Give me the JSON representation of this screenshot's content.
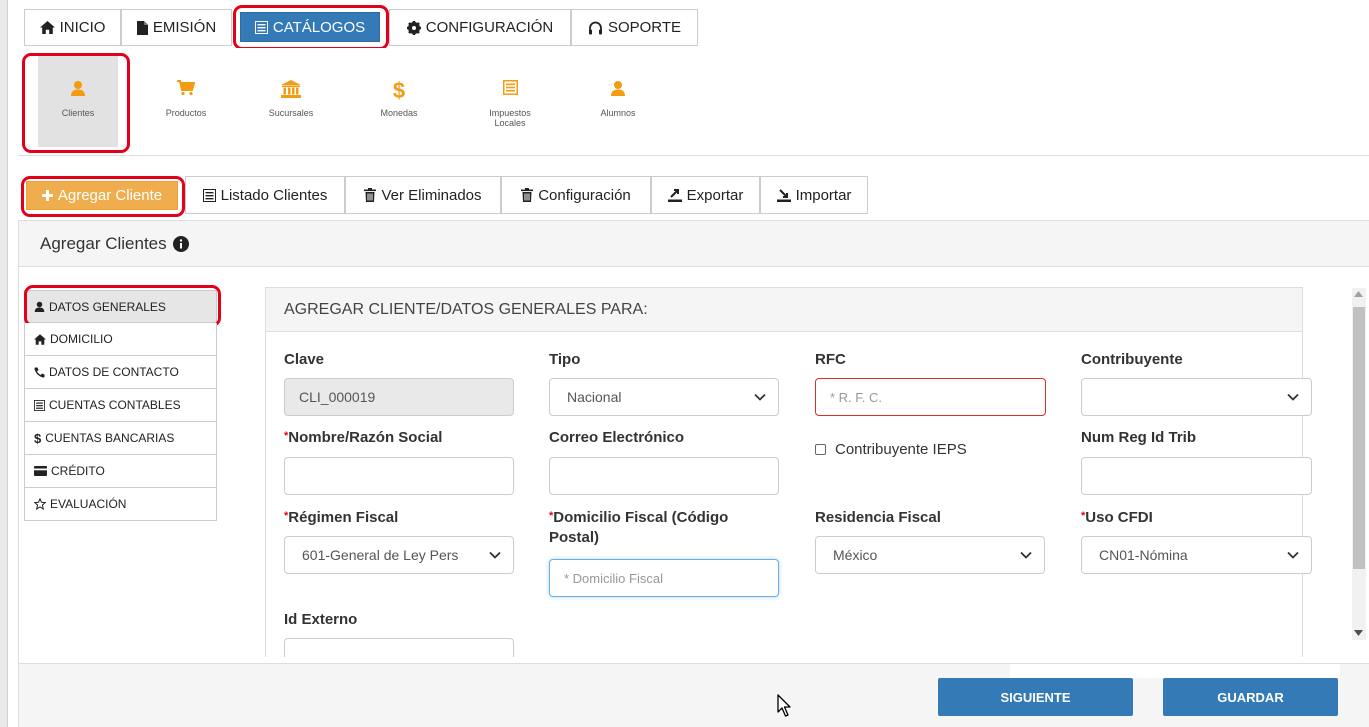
{
  "nav": {
    "inicio": "INICIO",
    "emision": "EMISIÓN",
    "catalogos": "CATÁLOGOS",
    "configuracion": "CONFIGURACIÓN",
    "soporte": "SOPORTE"
  },
  "catalogs": {
    "clientes": "Clientes",
    "productos": "Productos",
    "sucursales": "Sucursales",
    "monedas": "Monedas",
    "impuestos_line1": "Impuestos",
    "impuestos_line2": "Locales",
    "alumnos": "Alumnos"
  },
  "actions": {
    "agregar": "Agregar Cliente",
    "listado": "Listado Clientes",
    "eliminados": "Ver Eliminados",
    "configuracion": "Configuración",
    "exportar": "Exportar",
    "importar": "Importar"
  },
  "panel": {
    "title": "Agregar Clientes"
  },
  "side_tabs": {
    "datos_generales": "DATOS GENERALES",
    "domicilio": "DOMICILIO",
    "datos_contacto": "DATOS DE CONTACTO",
    "cuentas_contables": "CUENTAS CONTABLES",
    "cuentas_bancarias": "CUENTAS BANCARIAS",
    "credito": "CRÉDITO",
    "evaluacion": "EVALUACIÓN"
  },
  "form": {
    "header": "AGREGAR CLIENTE/DATOS GENERALES PARA:",
    "clave_label": "Clave",
    "clave_value": "CLI_000019",
    "tipo_label": "Tipo",
    "tipo_value": "Nacional",
    "rfc_label": "RFC",
    "rfc_placeholder": "* R. F. C.",
    "contribuyente_label": "Contribuyente",
    "contribuyente_value": "",
    "nombre_label": "Nombre/Razón Social",
    "correo_label": "Correo Electrónico",
    "ieps_label": "Contribuyente IEPS",
    "numreg_label": "Num Reg Id Trib",
    "regimen_label": "Régimen Fiscal",
    "regimen_value": "601-General de Ley Pers",
    "domicilio_label_line1": "Domicilio Fiscal (Código",
    "domicilio_label_line2": "Postal)",
    "domicilio_placeholder": "* Domicilio Fiscal",
    "residencia_label": "Residencia Fiscal",
    "residencia_value": "México",
    "uso_label": "Uso CFDI",
    "uso_value": "CN01-Nómina",
    "idexterno_label": "Id Externo",
    "required_mark": "*"
  },
  "footer": {
    "siguiente": "SIGUIENTE",
    "guardar": "GUARDAR"
  },
  "colors": {
    "primary": "#337ab7",
    "warning": "#f0ad4e",
    "icon_orange": "#f39c12",
    "highlight_red": "#e3001b"
  }
}
